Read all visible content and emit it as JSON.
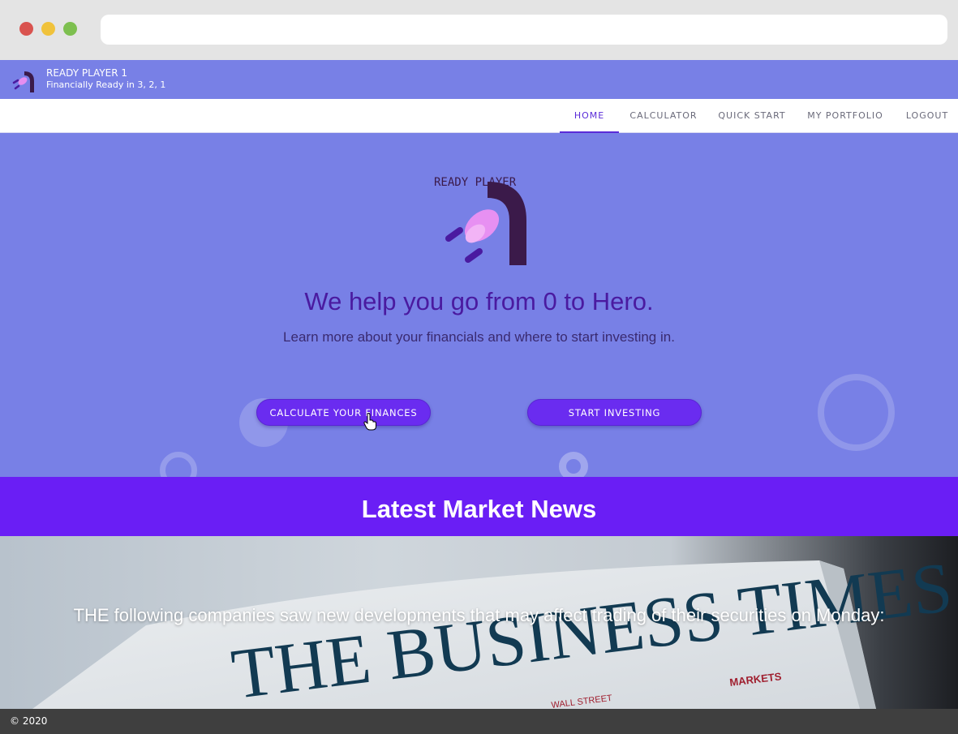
{
  "app": {
    "title": "READY PLAYER 1",
    "subtitle": "Financially Ready in 3, 2, 1",
    "logo_text": "READY PLAYER"
  },
  "nav": {
    "items": [
      {
        "label": "HOME",
        "active": true
      },
      {
        "label": "CALCULATOR",
        "active": false
      },
      {
        "label": "QUICK START",
        "active": false
      },
      {
        "label": "MY PORTFOLIO",
        "active": false
      },
      {
        "label": "LOGOUT",
        "active": false
      }
    ]
  },
  "hero": {
    "title": "We help you go from 0 to Hero.",
    "subtitle": "Learn more about your financials and where to start investing in.",
    "calc_button": "CALCULATE YOUR FINANCES",
    "invest_button": "START INVESTING"
  },
  "news": {
    "heading": "Latest Market News",
    "headline": "THE following companies saw new developments that may affect trading of their securities on Monday:",
    "image_masthead": "THE BUSINESS TIMES",
    "image_section": "MARKETS",
    "image_street": "WALL STREET"
  },
  "footer": {
    "copyright": "© 2020"
  },
  "colors": {
    "primary": "#7880e6",
    "accent": "#6a1ef5",
    "title": "#4a1aa0"
  }
}
